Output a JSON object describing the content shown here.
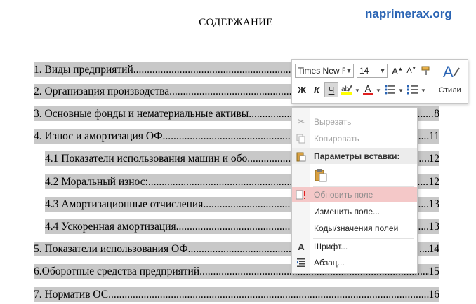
{
  "watermark": "naprimerax.org",
  "document": {
    "title": "СОДЕРЖАНИЕ",
    "toc": [
      {
        "text": "1. Виды предприятий",
        "page": ""
      },
      {
        "text": "2. Организация производства",
        "page": ""
      },
      {
        "text": "3. Основные фонды и нематериальные активы",
        "page": "8"
      },
      {
        "text": "4. Износ и амортизация ОФ",
        "page": "11"
      },
      {
        "text": "4.1 Показатели использования машин и обо",
        "page": "12"
      },
      {
        "text": "4.2 Моральный износ:",
        "page": "12"
      },
      {
        "text": "4.3 Амортизационные отчисления",
        "page": "13"
      },
      {
        "text": "4.4 Ускоренная амортизация",
        "page": "13"
      },
      {
        "text": "5. Показатели использования ОФ.",
        "page": "14"
      },
      {
        "text": "6.Оборотные средства предприятий",
        "page": "15"
      },
      {
        "text": "7. Норматив ОС",
        "page": "16"
      }
    ]
  },
  "mini_toolbar": {
    "font_name": "Times New Ro",
    "font_size": "14",
    "bold": "Ж",
    "italic": "К",
    "underline": "Ч",
    "font_color_letter": "A",
    "styles_label": "Стили",
    "colors": {
      "highlight": "#ffff00",
      "font": "#e02020"
    }
  },
  "context_menu": {
    "cut": "Вырезать",
    "copy": "Копировать",
    "paste_options_header": "Параметры вставки:",
    "update_field": "Обновить поле",
    "edit_field": "Изменить поле...",
    "toggle_field_codes": "Коды/значения полей",
    "font": "Шрифт...",
    "paragraph": "Абзац...",
    "font_icon_letter": "A"
  }
}
